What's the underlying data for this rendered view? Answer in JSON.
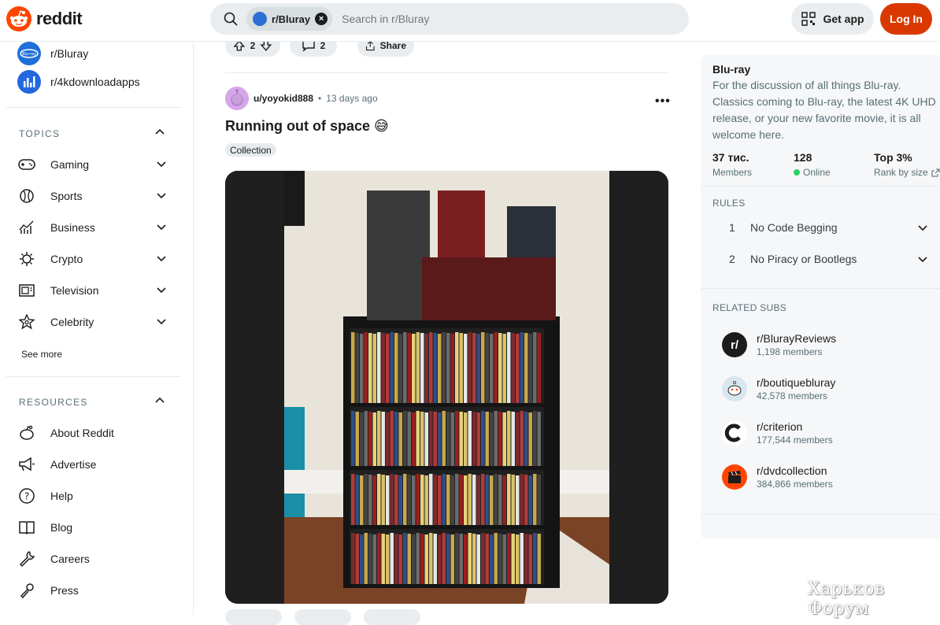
{
  "brand": {
    "name": "reddit"
  },
  "search": {
    "chip_label": "r/Bluray",
    "placeholder": "Search in r/Bluray"
  },
  "header": {
    "get_app": "Get app",
    "login": "Log In"
  },
  "sidebar": {
    "communities": [
      {
        "name": "r/Bluray"
      },
      {
        "name": "r/4kdownloadapps"
      }
    ],
    "topics_title": "TOPICS",
    "topics": [
      {
        "label": "Gaming",
        "icon": "gamepad-icon"
      },
      {
        "label": "Sports",
        "icon": "ball-icon"
      },
      {
        "label": "Business",
        "icon": "chart-icon"
      },
      {
        "label": "Crypto",
        "icon": "crypto-icon"
      },
      {
        "label": "Television",
        "icon": "tv-icon"
      },
      {
        "label": "Celebrity",
        "icon": "star-icon"
      }
    ],
    "see_more": "See more",
    "resources_title": "RESOURCES",
    "resources": [
      {
        "label": "About Reddit"
      },
      {
        "label": "Advertise"
      },
      {
        "label": "Help"
      },
      {
        "label": "Blog"
      },
      {
        "label": "Careers"
      },
      {
        "label": "Press"
      }
    ]
  },
  "prev_post": {
    "votes": "2",
    "comments": "2",
    "share": "Share"
  },
  "post": {
    "author": "u/yoyokid888",
    "separator": "•",
    "age": "13 days ago",
    "title": "Running out of space 😅",
    "flair": "Collection"
  },
  "right": {
    "title": "Blu-ray",
    "description": "For the discussion of all things Blu-ray. Classics coming to Blu-ray, the latest 4K UHD release, or your new favorite movie, it is all welcome here.",
    "stats": [
      {
        "value": "37 тис.",
        "label": "Members"
      },
      {
        "value": "128",
        "label": "Online"
      },
      {
        "value": "Top 3%",
        "label": "Rank by size"
      }
    ],
    "rules_title": "RULES",
    "rules": [
      {
        "num": "1",
        "text": "No Code Begging"
      },
      {
        "num": "2",
        "text": "No Piracy or Bootlegs"
      }
    ],
    "related_title": "RELATED SUBS",
    "related": [
      {
        "name": "r/BlurayReviews",
        "members": "1,198 members",
        "color": "#1c1c1c"
      },
      {
        "name": "r/boutiquebluray",
        "members": "42,578 members",
        "color": "#d8e6f0"
      },
      {
        "name": "r/criterion",
        "members": "177,544 members",
        "color": "#ffffff"
      },
      {
        "name": "r/dvdcollection",
        "members": "384,866 members",
        "color": "#ff4500"
      }
    ]
  },
  "watermark": "Харьков Форум",
  "colors": {
    "accent": "#ff4500",
    "login": "#d93900",
    "online": "#2ad05f"
  }
}
